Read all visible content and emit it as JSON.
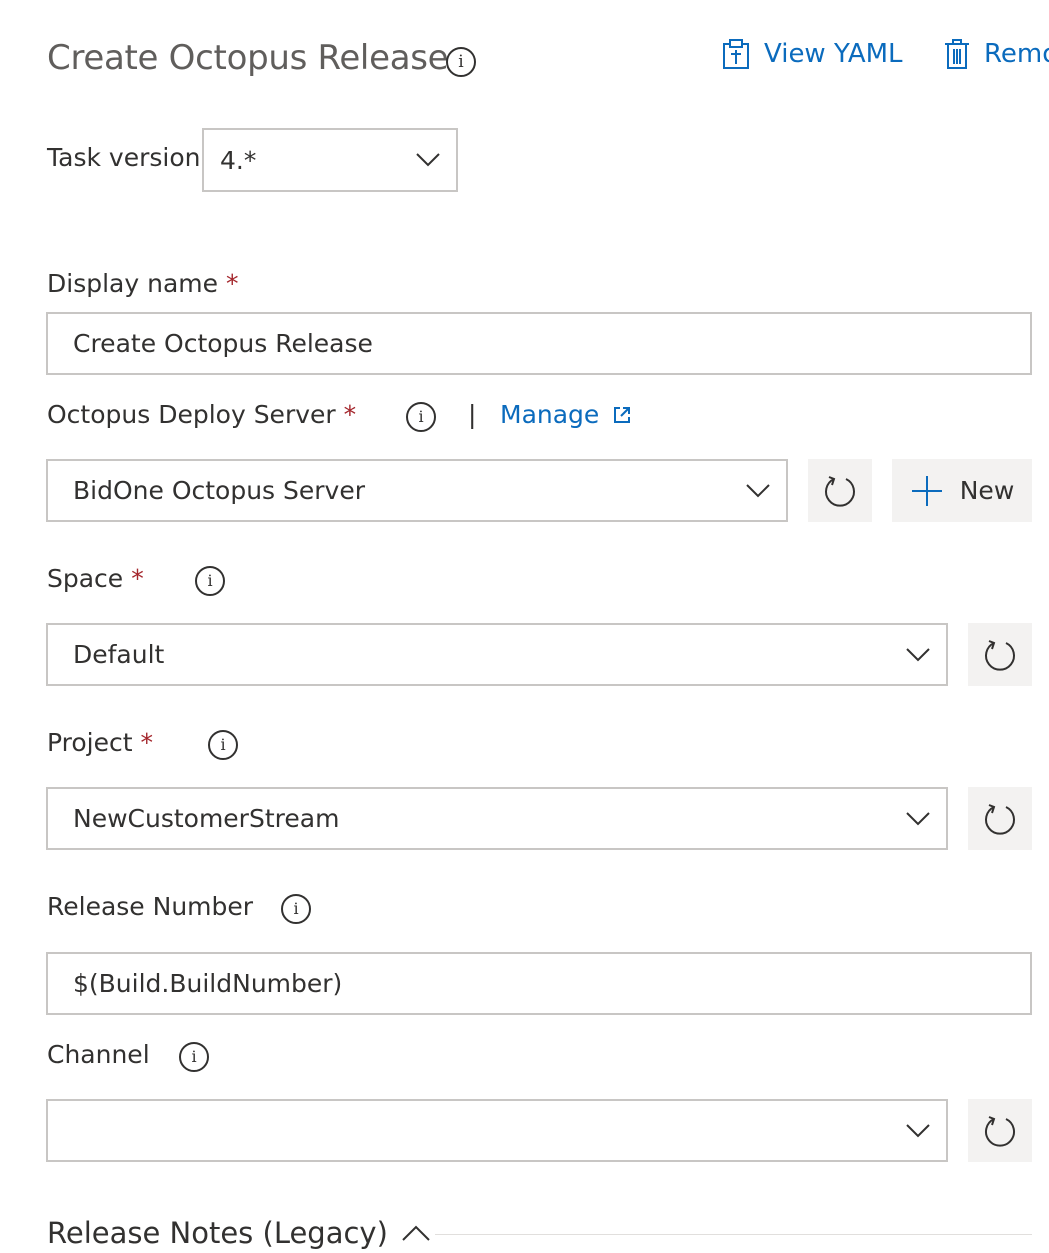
{
  "header": {
    "title": "Create Octopus Release",
    "info_icon": "info-icon",
    "view_yaml_label": "View YAML",
    "view_yaml_icon": "clipboard-icon",
    "remove_label": "Remove",
    "remove_icon": "trash-icon"
  },
  "task_version": {
    "label": "Task version",
    "value": "4.*"
  },
  "display_name": {
    "label": "Display name",
    "required_mark": "*",
    "value": "Create Octopus Release"
  },
  "server": {
    "label": "Octopus Deploy Server",
    "required_mark": "*",
    "separator": "|",
    "manage_label": "Manage",
    "manage_icon": "external-link-icon",
    "value": "BidOne Octopus Server",
    "refresh_icon": "refresh-icon",
    "new_label": "New",
    "new_icon": "plus-icon"
  },
  "space": {
    "label": "Space",
    "required_mark": "*",
    "value": "Default"
  },
  "project": {
    "label": "Project",
    "required_mark": "*",
    "value": "NewCustomerStream"
  },
  "release_number": {
    "label": "Release Number",
    "value": "$(Build.BuildNumber)"
  },
  "channel": {
    "label": "Channel",
    "value": ""
  },
  "release_notes": {
    "label": "Release Notes (Legacy)",
    "toggle_icon": "chevron-up-icon"
  },
  "colors": {
    "accent": "#0b6bbd",
    "required": "#a4262c",
    "border": "#c8c6c4",
    "button_bg": "#f3f2f1"
  }
}
